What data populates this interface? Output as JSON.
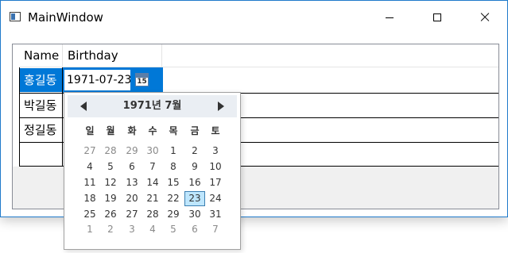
{
  "window": {
    "title": "MainWindow"
  },
  "grid": {
    "columns": [
      "Name",
      "Birthday"
    ],
    "rows": [
      {
        "name": "홍길동",
        "birthday": "1971-07-23"
      },
      {
        "name": "박길동",
        "birthday": ""
      },
      {
        "name": "정길동",
        "birthday": ""
      },
      {
        "name": "",
        "birthday": ""
      }
    ]
  },
  "calendar_button": {
    "day": "15"
  },
  "calendar": {
    "month_title": "1971년 7월",
    "day_names": [
      "일",
      "월",
      "화",
      "수",
      "목",
      "금",
      "토"
    ],
    "weeks": [
      [
        "27",
        "28",
        "29",
        "30",
        "1",
        "2",
        "3"
      ],
      [
        "4",
        "5",
        "6",
        "7",
        "8",
        "9",
        "10"
      ],
      [
        "11",
        "12",
        "13",
        "14",
        "15",
        "16",
        "17"
      ],
      [
        "18",
        "19",
        "20",
        "21",
        "22",
        "23",
        "24"
      ],
      [
        "25",
        "26",
        "27",
        "28",
        "29",
        "30",
        "31"
      ],
      [
        "1",
        "2",
        "3",
        "4",
        "5",
        "6",
        "7"
      ]
    ],
    "selected": "23"
  }
}
